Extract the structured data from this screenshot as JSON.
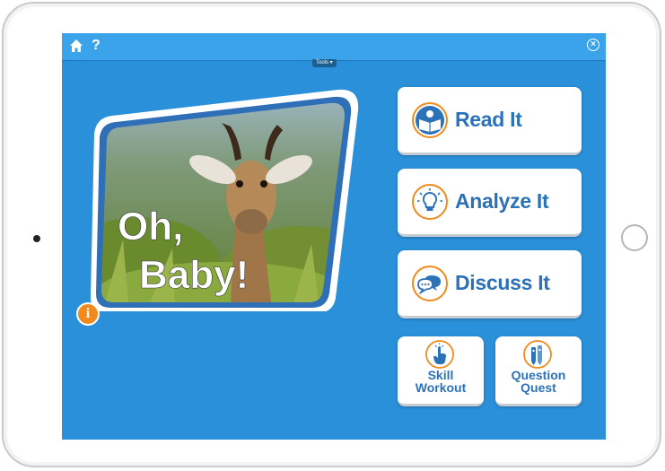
{
  "toolbar": {
    "home_icon": "home-icon",
    "help_label": "?",
    "close_icon": "close-icon",
    "tools_tab_label": "Tools ▾"
  },
  "cover": {
    "title_line1": "Oh,",
    "title_line2": "Baby!",
    "info_label": "i"
  },
  "actions": {
    "read": {
      "label": "Read It",
      "icon": "book-reader-icon"
    },
    "analyze": {
      "label": "Analyze It",
      "icon": "lightbulb-icon"
    },
    "discuss": {
      "label": "Discuss It",
      "icon": "chat-bubbles-icon"
    },
    "skill": {
      "label": "Skill\nWorkout",
      "icon": "pointing-hand-icon"
    },
    "question": {
      "label": "Question\nQuest",
      "icon": "pencils-icon"
    }
  },
  "colors": {
    "screen_bg": "#2a90d9",
    "topbar_bg": "#3aa3ea",
    "button_text": "#2b72b8",
    "icon_ring": "#f08a1c",
    "info_badge": "#f08a1c"
  }
}
